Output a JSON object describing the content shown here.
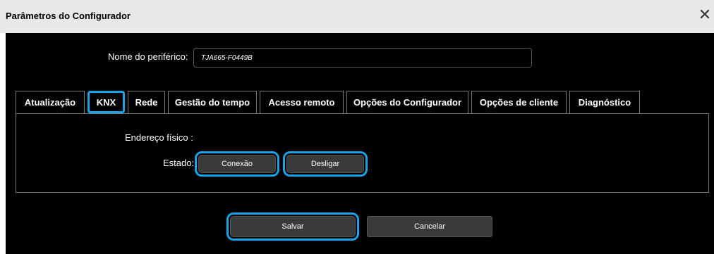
{
  "window": {
    "title": "Parâmetros do Configurador",
    "close_icon": "close-icon"
  },
  "peripheral": {
    "label": "Nome do periférico:",
    "value": "TJA665-F0449B"
  },
  "tabs": [
    {
      "label": "Atualização",
      "active": false
    },
    {
      "label": "KNX",
      "active": true
    },
    {
      "label": "Rede",
      "active": false
    },
    {
      "label": "Gestão do tempo",
      "active": false
    },
    {
      "label": "Acesso remoto",
      "active": false
    },
    {
      "label": "Opções do Configurador",
      "active": false
    },
    {
      "label": "Opções de cliente",
      "active": false
    },
    {
      "label": "Diagnóstico",
      "active": false
    }
  ],
  "knx": {
    "address_label": "Endereço físico :",
    "state_label": "Estado:",
    "connect_label": "Conexão",
    "disconnect_label": "Desligar"
  },
  "footer": {
    "save_label": "Salvar",
    "cancel_label": "Cancelar"
  },
  "colors": {
    "highlight": "#1aa3e8",
    "panel_bg": "#000000",
    "titlebar_bg": "#e8e8e8",
    "button_bg": "#3a3a3a"
  }
}
